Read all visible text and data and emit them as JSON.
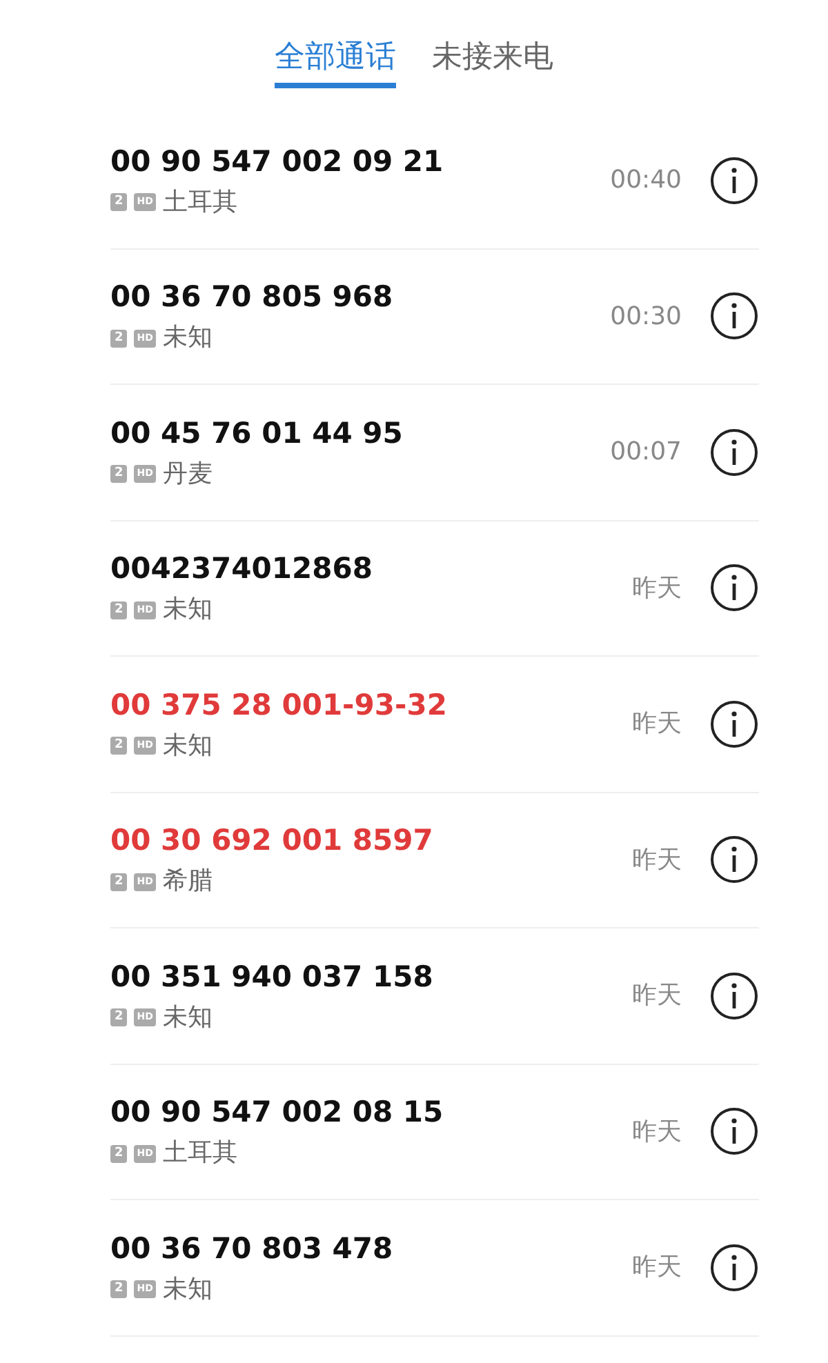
{
  "tabs": [
    {
      "label": "全部通话",
      "selected": true
    },
    {
      "label": "未接来电",
      "selected": false
    }
  ],
  "calls": [
    {
      "number": "00 90 547 002 09 21",
      "missed": false,
      "sim": "2",
      "hd": "HD",
      "location": "土耳其",
      "time": "00:40"
    },
    {
      "number": "00 36 70 805 968",
      "missed": false,
      "sim": "2",
      "hd": "HD",
      "location": "未知",
      "time": "00:30"
    },
    {
      "number": "00 45 76 01 44 95",
      "missed": false,
      "sim": "2",
      "hd": "HD",
      "location": "丹麦",
      "time": "00:07"
    },
    {
      "number": "0042374012868",
      "missed": false,
      "sim": "2",
      "hd": "HD",
      "location": "未知",
      "time": "昨天"
    },
    {
      "number": "00 375 28 001-93-32",
      "missed": true,
      "sim": "2",
      "hd": "HD",
      "location": "未知",
      "time": "昨天"
    },
    {
      "number": "00 30 692 001 8597",
      "missed": true,
      "sim": "2",
      "hd": "HD",
      "location": "希腊",
      "time": "昨天"
    },
    {
      "number": "00 351 940 037 158",
      "missed": false,
      "sim": "2",
      "hd": "HD",
      "location": "未知",
      "time": "昨天"
    },
    {
      "number": "00 90 547 002 08 15",
      "missed": false,
      "sim": "2",
      "hd": "HD",
      "location": "土耳其",
      "time": "昨天"
    },
    {
      "number": "00 36 70 803 478",
      "missed": false,
      "sim": "2",
      "hd": "HD",
      "location": "未知",
      "time": "昨天"
    }
  ]
}
